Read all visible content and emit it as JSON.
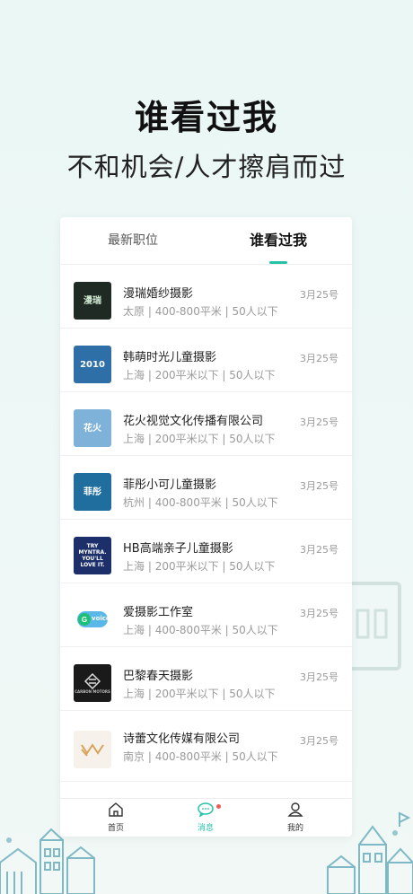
{
  "hero": {
    "title": "谁看过我",
    "subtitle": "不和机会/人才擦肩而过"
  },
  "tabs": [
    {
      "label": "最新职位",
      "active": false
    },
    {
      "label": "谁看过我",
      "active": true
    }
  ],
  "viewers": [
    {
      "company": "漫瑞婚纱摄影",
      "city": "太原",
      "size": "400-800平米",
      "staff": "50人以下",
      "date": "3月25号",
      "logo_text": "漫瑞"
    },
    {
      "company": "韩萌时光儿童摄影",
      "city": "上海",
      "size": "200平米以下",
      "staff": "50人以下",
      "date": "3月25号",
      "logo_text": "2010"
    },
    {
      "company": "花火视觉文化传播有限公司",
      "city": "上海",
      "size": "200平米以下",
      "staff": "50人以下",
      "date": "3月25号",
      "logo_text": "花火"
    },
    {
      "company": "菲彤小可儿童摄影",
      "city": "杭州",
      "size": "400-800平米",
      "staff": "50人以下",
      "date": "3月25号",
      "logo_text": "菲彤"
    },
    {
      "company": "HB高端亲子儿童摄影",
      "city": "上海",
      "size": "200平米以下",
      "staff": "50人以下",
      "date": "3月25号",
      "logo_text": "TRY MYNTRA. YOU'LL LOVE IT."
    },
    {
      "company": "爱摄影工作室",
      "city": "上海",
      "size": "400-800平米",
      "staff": "50人以下",
      "date": "3月25号",
      "logo_text": "voice"
    },
    {
      "company": "巴黎春天摄影",
      "city": "上海",
      "size": "200平米以下",
      "staff": "50人以下",
      "date": "3月25号",
      "logo_text": "CARBON MOTORS"
    },
    {
      "company": "诗蕾文化传媒有限公司",
      "city": "南京",
      "size": "400-800平米",
      "staff": "50人以下",
      "date": "3月25号",
      "logo_text": ""
    }
  ],
  "tabbar": {
    "home": "首页",
    "messages": "消息",
    "profile": "我的"
  },
  "colors": {
    "accent": "#22c3a7",
    "badge": "#f05a5a",
    "background": "#eaf7f5"
  }
}
